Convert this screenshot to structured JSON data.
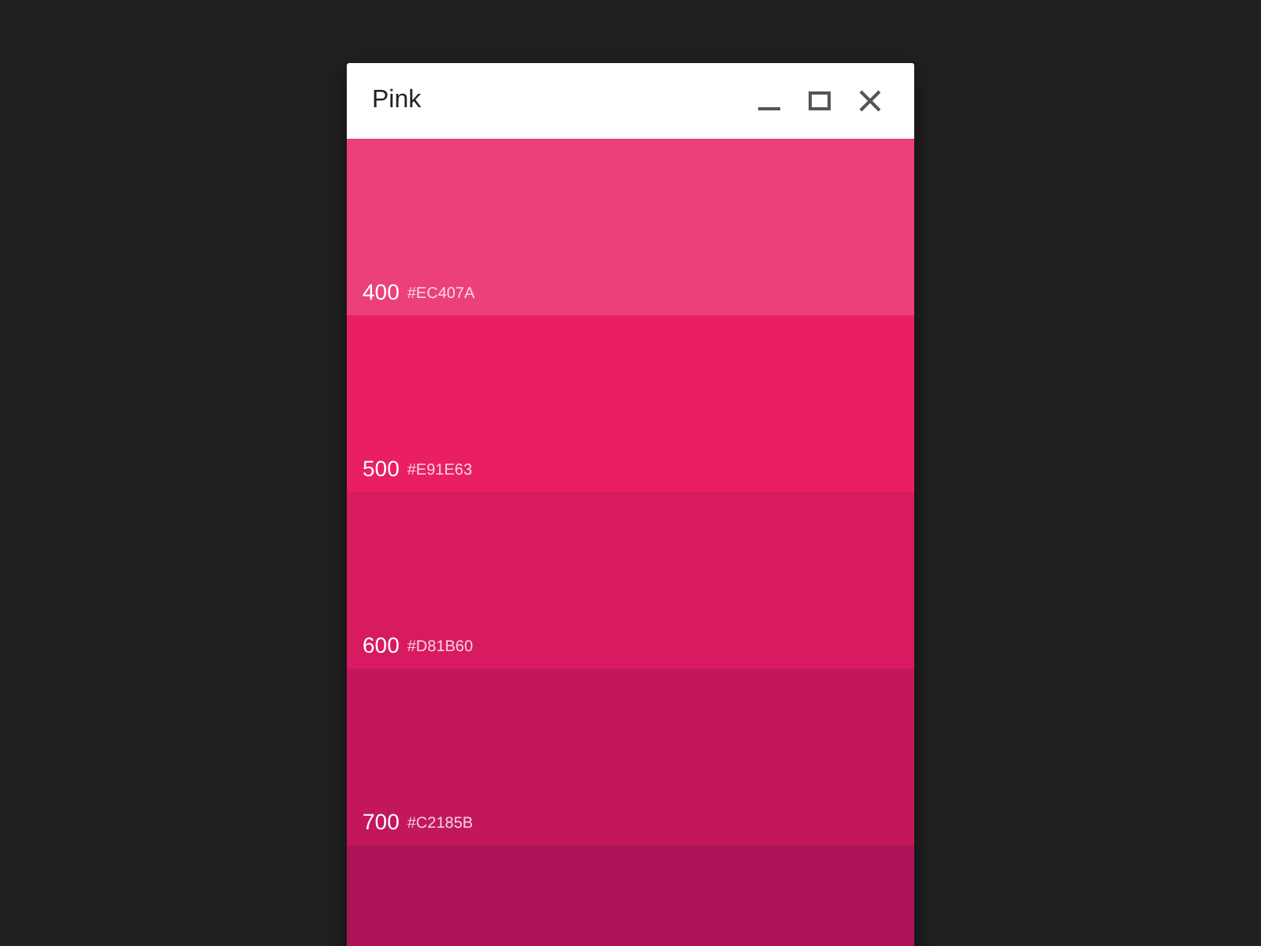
{
  "window": {
    "title": "Pink"
  },
  "swatches": [
    {
      "shade": "400",
      "hex": "#EC407A",
      "color": "#ec407a"
    },
    {
      "shade": "500",
      "hex": "#E91E63",
      "color": "#e91e63"
    },
    {
      "shade": "600",
      "hex": "#D81B60",
      "color": "#d81b60"
    },
    {
      "shade": "700",
      "hex": "#C2185B",
      "color": "#c2185b"
    },
    {
      "color": "#ad1457"
    }
  ]
}
